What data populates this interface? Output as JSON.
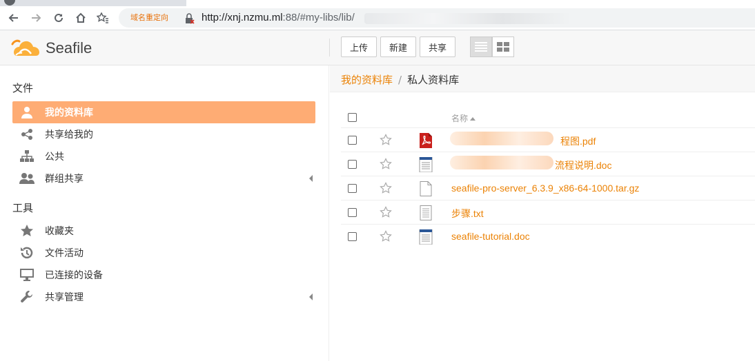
{
  "browser": {
    "redirect_chip": "域名重定向",
    "url_host": "http://xnj.nzmu.ml",
    "url_rest": ":88/#my-libs/lib/"
  },
  "app": {
    "logo_text": "Seafile"
  },
  "toolbar": {
    "upload": "上传",
    "new": "新建",
    "share": "共享"
  },
  "sidebar": {
    "files_heading": "文件",
    "tools_heading": "工具",
    "file_items": [
      {
        "label": "我的资料库",
        "icon": "user-icon",
        "active": true
      },
      {
        "label": "共享给我的",
        "icon": "share-icon",
        "active": false
      },
      {
        "label": "公共",
        "icon": "sitemap-icon",
        "active": false
      },
      {
        "label": "群组共享",
        "icon": "group-icon",
        "active": false,
        "caret": true
      }
    ],
    "tool_items": [
      {
        "label": "收藏夹",
        "icon": "star-icon"
      },
      {
        "label": "文件活动",
        "icon": "history-icon"
      },
      {
        "label": "已连接的设备",
        "icon": "monitor-icon"
      },
      {
        "label": "共享管理",
        "icon": "wrench-icon",
        "caret": true
      }
    ]
  },
  "breadcrumb": {
    "root": "我的资料库",
    "separator": "/",
    "current": "私人资料库"
  },
  "table": {
    "name_header": "名称",
    "files": [
      {
        "name": "程图.pdf",
        "type": "pdf",
        "redacted": true
      },
      {
        "name": "流程说明.doc",
        "type": "doc",
        "redacted": true
      },
      {
        "name": "seafile-pro-server_6.3.9_x86-64-1000.tar.gz",
        "type": "generic",
        "redacted": false
      },
      {
        "name": "步骤.txt",
        "type": "txt",
        "redacted": false
      },
      {
        "name": "seafile-tutorial.doc",
        "type": "doc",
        "redacted": false
      }
    ]
  },
  "colors": {
    "accent": "#eb8205",
    "active_nav": "#feac74"
  }
}
